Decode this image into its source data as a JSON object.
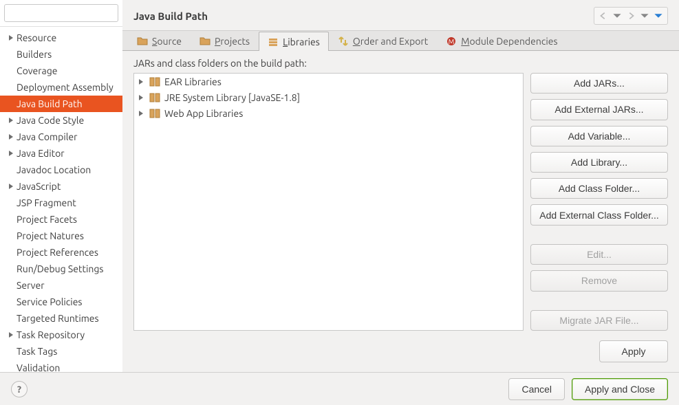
{
  "sidebar": {
    "search_placeholder": "",
    "items": [
      {
        "label": "Resource",
        "expandable": true
      },
      {
        "label": "Builders",
        "expandable": false
      },
      {
        "label": "Coverage",
        "expandable": false
      },
      {
        "label": "Deployment Assembly",
        "expandable": false
      },
      {
        "label": "Java Build Path",
        "expandable": false,
        "selected": true
      },
      {
        "label": "Java Code Style",
        "expandable": true
      },
      {
        "label": "Java Compiler",
        "expandable": true
      },
      {
        "label": "Java Editor",
        "expandable": true
      },
      {
        "label": "Javadoc Location",
        "expandable": false
      },
      {
        "label": "JavaScript",
        "expandable": true
      },
      {
        "label": "JSP Fragment",
        "expandable": false
      },
      {
        "label": "Project Facets",
        "expandable": false
      },
      {
        "label": "Project Natures",
        "expandable": false
      },
      {
        "label": "Project References",
        "expandable": false
      },
      {
        "label": "Run/Debug Settings",
        "expandable": false
      },
      {
        "label": "Server",
        "expandable": false
      },
      {
        "label": "Service Policies",
        "expandable": false
      },
      {
        "label": "Targeted Runtimes",
        "expandable": false
      },
      {
        "label": "Task Repository",
        "expandable": true
      },
      {
        "label": "Task Tags",
        "expandable": false
      },
      {
        "label": "Validation",
        "expandable": false
      }
    ]
  },
  "header": {
    "title": "Java Build Path"
  },
  "tabs": [
    {
      "label": "Source",
      "mn": "S"
    },
    {
      "label": "Projects",
      "mn": "P"
    },
    {
      "label": "Libraries",
      "mn": "L",
      "active": true
    },
    {
      "label": "Order and Export",
      "mn": "O"
    },
    {
      "label": "Module Dependencies",
      "mn": "M"
    }
  ],
  "content": {
    "instruction": "JARs and class folders on the build path:",
    "libraries": [
      {
        "label": "EAR Libraries"
      },
      {
        "label": "JRE System Library [JavaSE-1.8]"
      },
      {
        "label": "Web App Libraries"
      }
    ],
    "buttons": {
      "add_jars": "Add JARs...",
      "add_ext_jars": "Add External JARs...",
      "add_variable": "Add Variable...",
      "add_library": "Add Library...",
      "add_class_folder": "Add Class Folder...",
      "add_ext_class_folder": "Add External Class Folder...",
      "edit": "Edit...",
      "remove": "Remove",
      "migrate": "Migrate JAR File..."
    },
    "apply": "Apply"
  },
  "footer": {
    "help": "?",
    "cancel": "Cancel",
    "apply_close": "Apply and Close"
  }
}
